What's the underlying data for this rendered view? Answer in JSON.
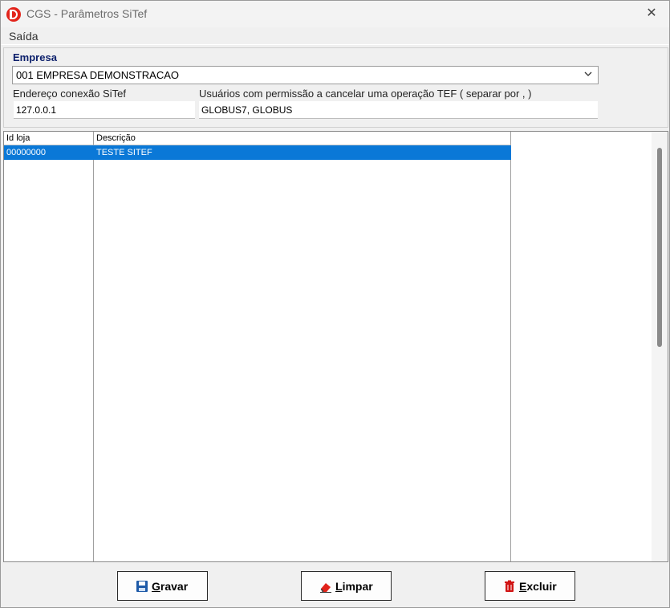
{
  "window": {
    "title": "CGS - Parâmetros SiTef"
  },
  "menu": {
    "items": [
      "Saída"
    ]
  },
  "form": {
    "empresa_label": "Empresa",
    "empresa_value": "001 EMPRESA DEMONSTRACAO",
    "endereco_label": "Endereço conexão SiTef",
    "endereco_value": "127.0.0.1",
    "usuarios_label": "Usuários com permissão a cancelar uma operação TEF ( separar por , )",
    "usuarios_value": "GLOBUS7, GLOBUS"
  },
  "grid": {
    "columns": [
      "Id loja",
      "Descrição"
    ],
    "rows": [
      {
        "id": "00000000",
        "descricao": "TESTE SITEF",
        "selected": true
      }
    ]
  },
  "buttons": {
    "gravar": "Gravar",
    "limpar": "Limpar",
    "excluir": "Excluir"
  },
  "icons": {
    "app": "app-logo-icon",
    "close": "close-icon",
    "dropdown": "chevron-down-icon",
    "save": "floppy-disk-icon",
    "clear": "eraser-icon",
    "delete": "trash-icon"
  },
  "colors": {
    "selection": "#0a78d7",
    "label_blue": "#0b1f6b",
    "app_red": "#e2231a"
  }
}
